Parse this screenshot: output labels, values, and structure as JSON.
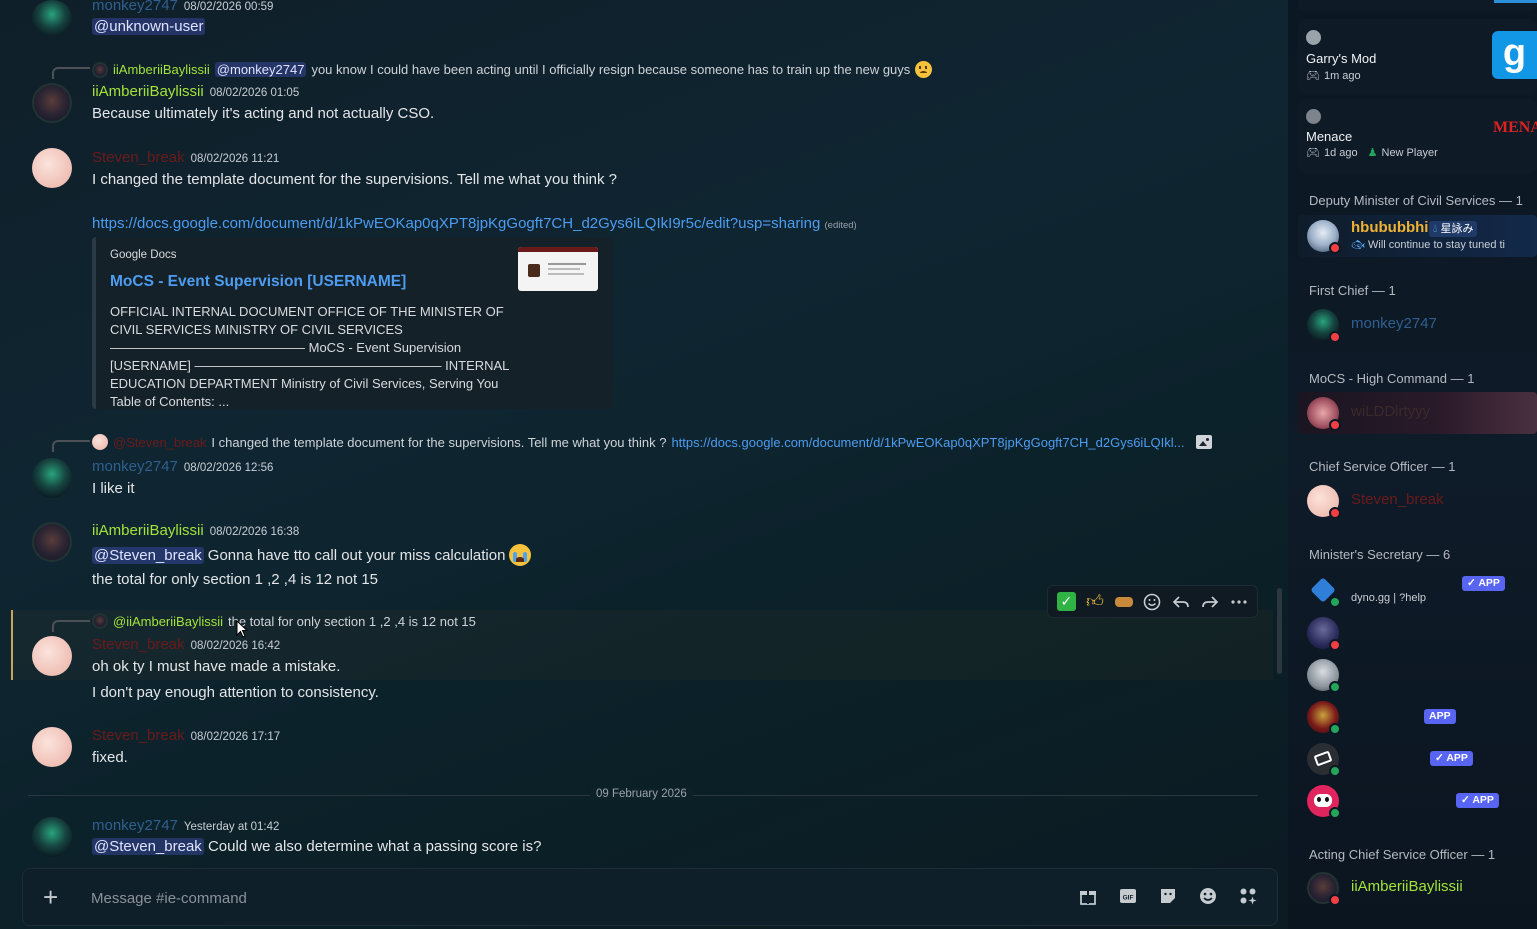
{
  "messages": {
    "m1": {
      "author": "monkey2747",
      "timestamp": "08/02/2026 00:59",
      "mention": "@unknown-user"
    },
    "m2": {
      "reply_author": "iiAmberiiBaylissii",
      "reply_mention": "@monkey2747",
      "reply_text": "you know I could have been acting until I officially resign because someone has to train up the new guys",
      "author": "iiAmberiiBaylissii",
      "timestamp": "08/02/2026 01:05",
      "text": "Because ultimately it's acting and not actually CSO."
    },
    "m3": {
      "author": "Steven_break",
      "timestamp": "08/02/2026 11:21",
      "text": "I changed the template document for the supervisions. Tell me what you think ?",
      "link": "https://docs.google.com/document/d/1kPwEOKap0qXPT8jpKgGogft7CH_d2Gys6iLQIkI9r5c/edit?usp=sharing",
      "edited": "(edited)",
      "embed": {
        "provider": "Google Docs",
        "title": "MoCS - Event Supervision [USERNAME]",
        "description": "OFFICIAL INTERNAL DOCUMENT OFFICE OF THE MINISTER OF CIVIL SERVICES MINISTRY OF CIVIL SERVICES ——————————————— MoCS - Event Supervision [USERNAME] ——————————————————— INTERNAL EDUCATION DEPARTMENT Ministry of Civil Services, Serving You Table of Contents: ..."
      }
    },
    "m4": {
      "reply_author": "@Steven_break",
      "reply_text": "I changed the template document for the supervisions. Tell me what you think ?",
      "reply_link": "https://docs.google.com/document/d/1kPwEOKap0qXPT8jpKgGogft7CH_d2Gys6iLQIkl...",
      "author": "monkey2747",
      "timestamp": "08/02/2026 12:56",
      "text": "I like it"
    },
    "m5": {
      "author": "iiAmberiiBaylissii",
      "timestamp": "08/02/2026 16:38",
      "mention": "@Steven_break",
      "text1": "Gonna have tto call out your miss calculation",
      "text2": "the total for only section 1 ,2 ,4 is 12 not 15"
    },
    "m6": {
      "reply_author": "@iiAmberiiBaylissii",
      "reply_text": "the total for only section 1 ,2 ,4 is 12 not 15",
      "author": "Steven_break",
      "timestamp": "08/02/2026 16:42",
      "text1": "oh ok ty I must have made a mistake.",
      "text2": "I don't pay enough attention to consistency."
    },
    "m7": {
      "author": "Steven_break",
      "timestamp": "08/02/2026 17:17",
      "text": "fixed."
    },
    "divider": "09 February 2026",
    "m8": {
      "author": "monkey2747",
      "timestamp": "Yesterday at 01:42",
      "mention": "@Steven_break",
      "text": "Could we also determine what a passing score is?"
    }
  },
  "composer": {
    "placeholder": "Message #ie-command"
  },
  "hover_actions": [
    "check-reaction",
    "thumbs-up-reaction",
    "custom-reaction",
    "add-reaction",
    "reply",
    "forward",
    "more"
  ],
  "sidebar": {
    "activities": [
      {
        "title": "Garry's Mod",
        "sub": "1m ago",
        "icon_letter": "g"
      },
      {
        "title": "Menace",
        "sub": "1d ago",
        "extra": "New Player",
        "art_text": "MENACE"
      }
    ],
    "roles": [
      {
        "head": "Deputy Minister of Civil Services — 1",
        "members": [
          {
            "name": "hbububbhi",
            "tag": "星詠み",
            "status_text": "Will continue to stay tuned ti"
          }
        ]
      },
      {
        "head": "First Chief — 1",
        "members": [
          {
            "name": "monkey2747"
          }
        ]
      },
      {
        "head": "MoCS - High Command — 1",
        "members": [
          {
            "name": "wiLDDlrtyyy"
          }
        ]
      },
      {
        "head": "Chief Service Officer — 1",
        "members": [
          {
            "name": "Steven_break"
          }
        ]
      },
      {
        "head": "Minister's Secretary — 6",
        "members": [
          {
            "name": "",
            "sub": "dyno.gg | ?help",
            "badge": "APP"
          },
          {
            "name": "",
            "sub": ""
          },
          {
            "name": "",
            "sub": ""
          },
          {
            "name": "",
            "badge": "APP"
          },
          {
            "name": "",
            "badge": "APP"
          },
          {
            "name": "",
            "badge": "APP"
          }
        ]
      },
      {
        "head": "Acting Chief Service Officer — 1",
        "members": [
          {
            "name": "iiAmberiiBaylissii"
          }
        ]
      }
    ]
  },
  "colors": {
    "monkey": "#2f5f8f",
    "amber": "#a4e33a",
    "steven": "#6b1a1a",
    "link": "#4d9cf0",
    "app_badge": "#5865f2"
  }
}
